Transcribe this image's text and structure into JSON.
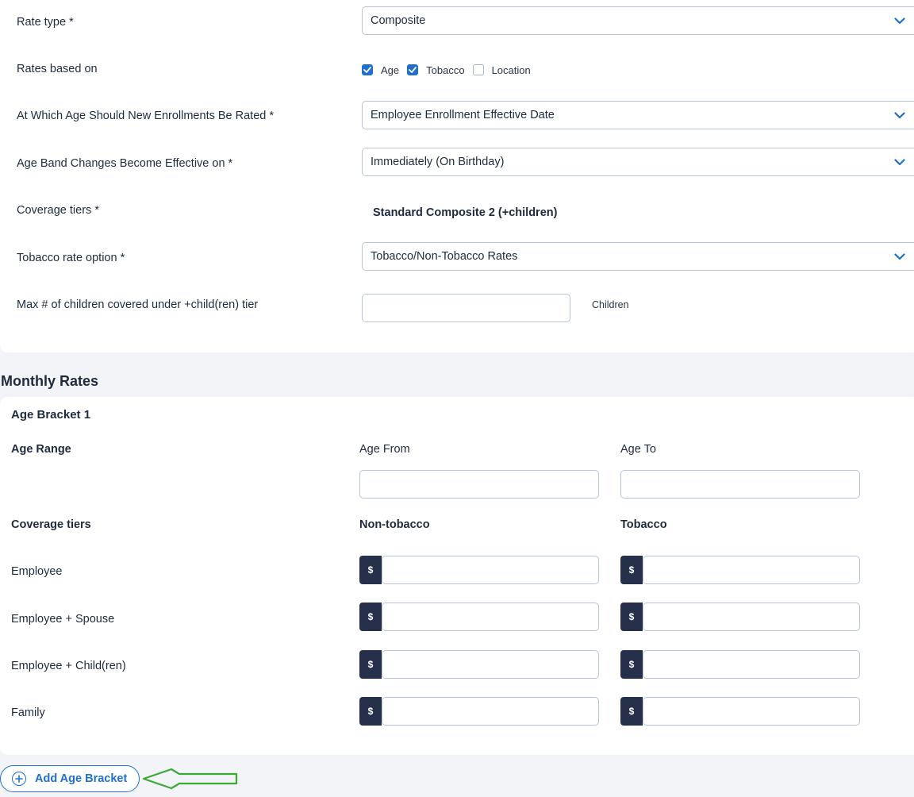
{
  "settings": {
    "rate_type": {
      "label": "Rate type *",
      "value": "Composite"
    },
    "rates_based_on": {
      "label": "Rates based on",
      "options": [
        {
          "label": "Age",
          "checked": true
        },
        {
          "label": "Tobacco",
          "checked": true
        },
        {
          "label": "Location",
          "checked": false
        }
      ]
    },
    "new_enrollment_age": {
      "label": "At Which Age Should New Enrollments Be Rated *",
      "value": "Employee Enrollment Effective Date"
    },
    "age_band_effective": {
      "label": "Age Band Changes Become Effective on *",
      "value": "Immediately (On Birthday)"
    },
    "coverage_tiers": {
      "label": "Coverage tiers *",
      "value": "Standard Composite 2 (+children)"
    },
    "tobacco_rate_option": {
      "label": "Tobacco rate option *",
      "value": "Tobacco/Non-Tobacco Rates"
    },
    "max_children": {
      "label": "Max # of children covered under +child(ren) tier",
      "value": "",
      "suffix": "Children"
    }
  },
  "monthly_rates": {
    "title": "Monthly Rates",
    "bracket": {
      "title": "Age Bracket 1",
      "age_range_label": "Age Range",
      "age_from_label": "Age From",
      "age_to_label": "Age To",
      "coverage_tiers_label": "Coverage tiers",
      "non_tobacco_label": "Non-tobacco",
      "tobacco_label": "Tobacco",
      "currency_symbol": "$",
      "tiers": [
        {
          "label": "Employee",
          "non_tobacco": "",
          "tobacco": ""
        },
        {
          "label": "Employee + Spouse",
          "non_tobacco": "",
          "tobacco": ""
        },
        {
          "label": "Employee + Child(ren)",
          "non_tobacco": "",
          "tobacco": ""
        },
        {
          "label": "Family",
          "non_tobacco": "",
          "tobacco": ""
        }
      ]
    },
    "add_button_label": "Add Age Bracket"
  },
  "colors": {
    "accent": "#1f6fd1",
    "dark": "#27304a",
    "arrow": "#3aaa35"
  },
  "icons": [
    "chevron-down-icon",
    "checkmark-icon",
    "plus-circle-icon",
    "arrow-left-icon"
  ]
}
